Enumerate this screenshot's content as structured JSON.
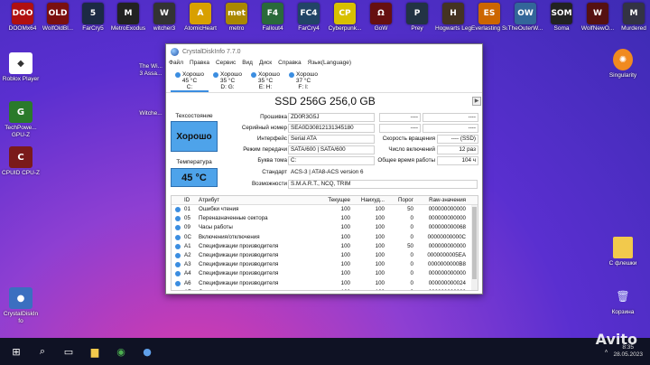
{
  "desktop": {
    "top_icons": [
      {
        "label": "DOOMx64",
        "glyph": "DOOM",
        "color": "#b01010"
      },
      {
        "label": "WolfOldBl...",
        "glyph": "OLD BLOOD",
        "color": "#7a1010"
      },
      {
        "label": "FarCry5",
        "glyph": "5",
        "color": "#1c2a44"
      },
      {
        "label": "MetroExodus",
        "glyph": "M",
        "color": "#222222"
      },
      {
        "label": "witcher3",
        "glyph": "W",
        "color": "#333333"
      },
      {
        "label": "AtomicHeart",
        "glyph": "A",
        "color": "#d8a000"
      },
      {
        "label": "metro",
        "glyph": "metro",
        "color": "#aa8800"
      },
      {
        "label": "Fallout4",
        "glyph": "F4",
        "color": "#2a6a3a"
      },
      {
        "label": "FarCry4",
        "glyph": "FC4",
        "color": "#224466"
      },
      {
        "label": "Cyberpunk...",
        "glyph": "CP",
        "color": "#d8c000"
      },
      {
        "label": "GoW",
        "glyph": "Ω",
        "color": "#661010"
      },
      {
        "label": "Prey",
        "glyph": "P",
        "color": "#223344"
      },
      {
        "label": "Hogwarts Legacy",
        "glyph": "H",
        "color": "#443322"
      },
      {
        "label": "Everlasting Summer",
        "glyph": "ES",
        "color": "#cc6600"
      },
      {
        "label": "TheOuterW...",
        "glyph": "OW",
        "color": "#336699"
      },
      {
        "label": "Soma",
        "glyph": "SOMA",
        "color": "#222222"
      },
      {
        "label": "WolfNewO...",
        "glyph": "W",
        "color": "#551111"
      },
      {
        "label": "Murdered",
        "glyph": "M",
        "color": "#333344"
      }
    ],
    "left_icons": [
      {
        "label": "Roblox Player",
        "glyph": "R",
        "color": "#ffffff"
      },
      {
        "label": "TechPowe... GPU-Z",
        "glyph": "GPU",
        "color": "#2a7a2a"
      },
      {
        "label": "CPUID CPU-Z",
        "glyph": "CPU",
        "color": "#7a1a1a"
      },
      {
        "label": "CrystalDiskIn fo",
        "glyph": "CDI",
        "color": "#3b6fc0"
      }
    ],
    "right_icons": [
      {
        "label": "Singularity",
        "glyph": "S"
      },
      {
        "label": "С флешки",
        "glyph": "folder-icon"
      },
      {
        "label": "Корзина",
        "glyph": "recycle-bin-icon"
      }
    ]
  },
  "window": {
    "title": "CrystalDiskInfo 7.7.0",
    "menu": [
      "Файл",
      "Правка",
      "Сервис",
      "Вид",
      "Диск",
      "Справка",
      "Язык(Language)"
    ],
    "drives": [
      {
        "status": "Хорошо",
        "temp": "45 °C",
        "letter": "C:",
        "selected": true
      },
      {
        "status": "Хорошо",
        "temp": "35 °C",
        "letter": "D: G:",
        "selected": false
      },
      {
        "status": "Хорошо",
        "temp": "35 °C",
        "letter": "E: H:",
        "selected": false
      },
      {
        "status": "Хорошо",
        "temp": "37 °C",
        "letter": "F: I:",
        "selected": false
      }
    ],
    "disk_title": "SSD 256G 256,0 GB",
    "health_label": "Техсостояние",
    "health_value": "Хорошо",
    "temp_label": "Температура",
    "temp_value": "45 °C",
    "fields": {
      "firmware": {
        "label": "Прошивка",
        "value": "ZD0R3G5J"
      },
      "serial": {
        "label": "Серийный номер",
        "value": "SEA0D30812131345180"
      },
      "interface": {
        "label": "Интерфейс",
        "value": "Serial ATA"
      },
      "transfer": {
        "label": "Режим передачи",
        "value": "SATA/600 | SATA/600"
      },
      "volume": {
        "label": "Буква тома",
        "value": "C:"
      },
      "standard": {
        "label": "Стандарт",
        "value": "ACS-3 | ATA8-ACS version 6"
      },
      "features": {
        "label": "Возможности",
        "value": "S.M.A.R.T., NCQ, TRIM"
      },
      "blank1": {
        "value": "----"
      },
      "blank2": {
        "value": "----"
      },
      "rotation": {
        "label": "Скорость вращения",
        "value": "---- (SSD)"
      },
      "power_count": {
        "label": "Число включений",
        "value": "12 раз"
      },
      "power_hours": {
        "label": "Общее время работы",
        "value": "104 ч"
      }
    },
    "smart": {
      "headers": [
        "ID",
        "Атрибут",
        "Текущее",
        "Наихуд...",
        "Порог",
        "Raw-значения"
      ],
      "rows": [
        {
          "id": "01",
          "attr": "Ошибки чтения",
          "cur": "100",
          "worst": "100",
          "thr": "50",
          "raw": "000000000000"
        },
        {
          "id": "05",
          "attr": "Переназначенные сектора",
          "cur": "100",
          "worst": "100",
          "thr": "0",
          "raw": "000000000000"
        },
        {
          "id": "09",
          "attr": "Часы работы",
          "cur": "100",
          "worst": "100",
          "thr": "0",
          "raw": "000000000068"
        },
        {
          "id": "0C",
          "attr": "Включения/отключения",
          "cur": "100",
          "worst": "100",
          "thr": "0",
          "raw": "00000000000C"
        },
        {
          "id": "A1",
          "attr": "Спецификации производителя",
          "cur": "100",
          "worst": "100",
          "thr": "50",
          "raw": "000000000000"
        },
        {
          "id": "A2",
          "attr": "Спецификации производителя",
          "cur": "100",
          "worst": "100",
          "thr": "0",
          "raw": "0000000005EA"
        },
        {
          "id": "A3",
          "attr": "Спецификации производителя",
          "cur": "100",
          "worst": "100",
          "thr": "0",
          "raw": "0000000000B8"
        },
        {
          "id": "A4",
          "attr": "Спецификации производителя",
          "cur": "100",
          "worst": "100",
          "thr": "0",
          "raw": "000000000000"
        },
        {
          "id": "A6",
          "attr": "Спецификации производителя",
          "cur": "100",
          "worst": "100",
          "thr": "0",
          "raw": "000000000024"
        },
        {
          "id": "A7",
          "attr": "Спецификации производителя",
          "cur": "100",
          "worst": "100",
          "thr": "0",
          "raw": "000000000000"
        }
      ]
    }
  },
  "taskbar": {
    "icons": [
      "windows-icon",
      "search-icon",
      "task-view-icon",
      "explorer-icon",
      "chrome-icon",
      "crystaldiskinfo-icon"
    ],
    "time": "8:35",
    "date": "28.05.2023",
    "watermark": "Avito"
  }
}
